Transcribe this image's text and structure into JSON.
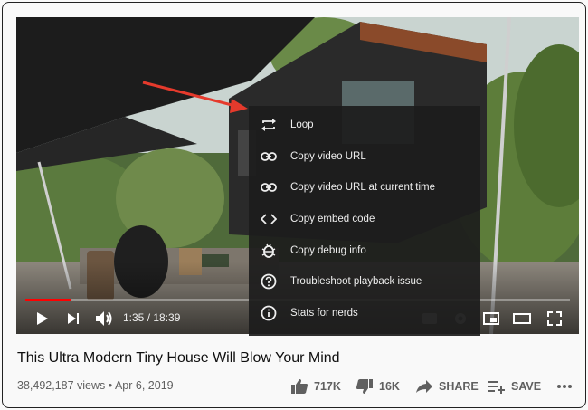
{
  "video": {
    "progress_fraction": 0.085,
    "current_time": "1:35",
    "duration": "18:39",
    "time_separator": " / "
  },
  "context_menu": {
    "items": [
      {
        "label": "Loop",
        "icon": "loop-icon"
      },
      {
        "label": "Copy video URL",
        "icon": "link-icon"
      },
      {
        "label": "Copy video URL at current time",
        "icon": "link-icon"
      },
      {
        "label": "Copy embed code",
        "icon": "embed-code-icon"
      },
      {
        "label": "Copy debug info",
        "icon": "bug-icon"
      },
      {
        "label": "Troubleshoot playback issue",
        "icon": "question-icon"
      },
      {
        "label": "Stats for nerds",
        "icon": "info-icon"
      }
    ]
  },
  "info": {
    "title": "This Ultra Modern Tiny House Will Blow Your Mind",
    "views": "38,492,187 views",
    "separator": "•",
    "date": "Apr 6, 2019",
    "likes": "717K",
    "dislikes": "16K",
    "share_label": "SHARE",
    "save_label": "SAVE"
  },
  "colors": {
    "progress": "#ff0000",
    "annotation_arrow": "#e53a2c"
  }
}
